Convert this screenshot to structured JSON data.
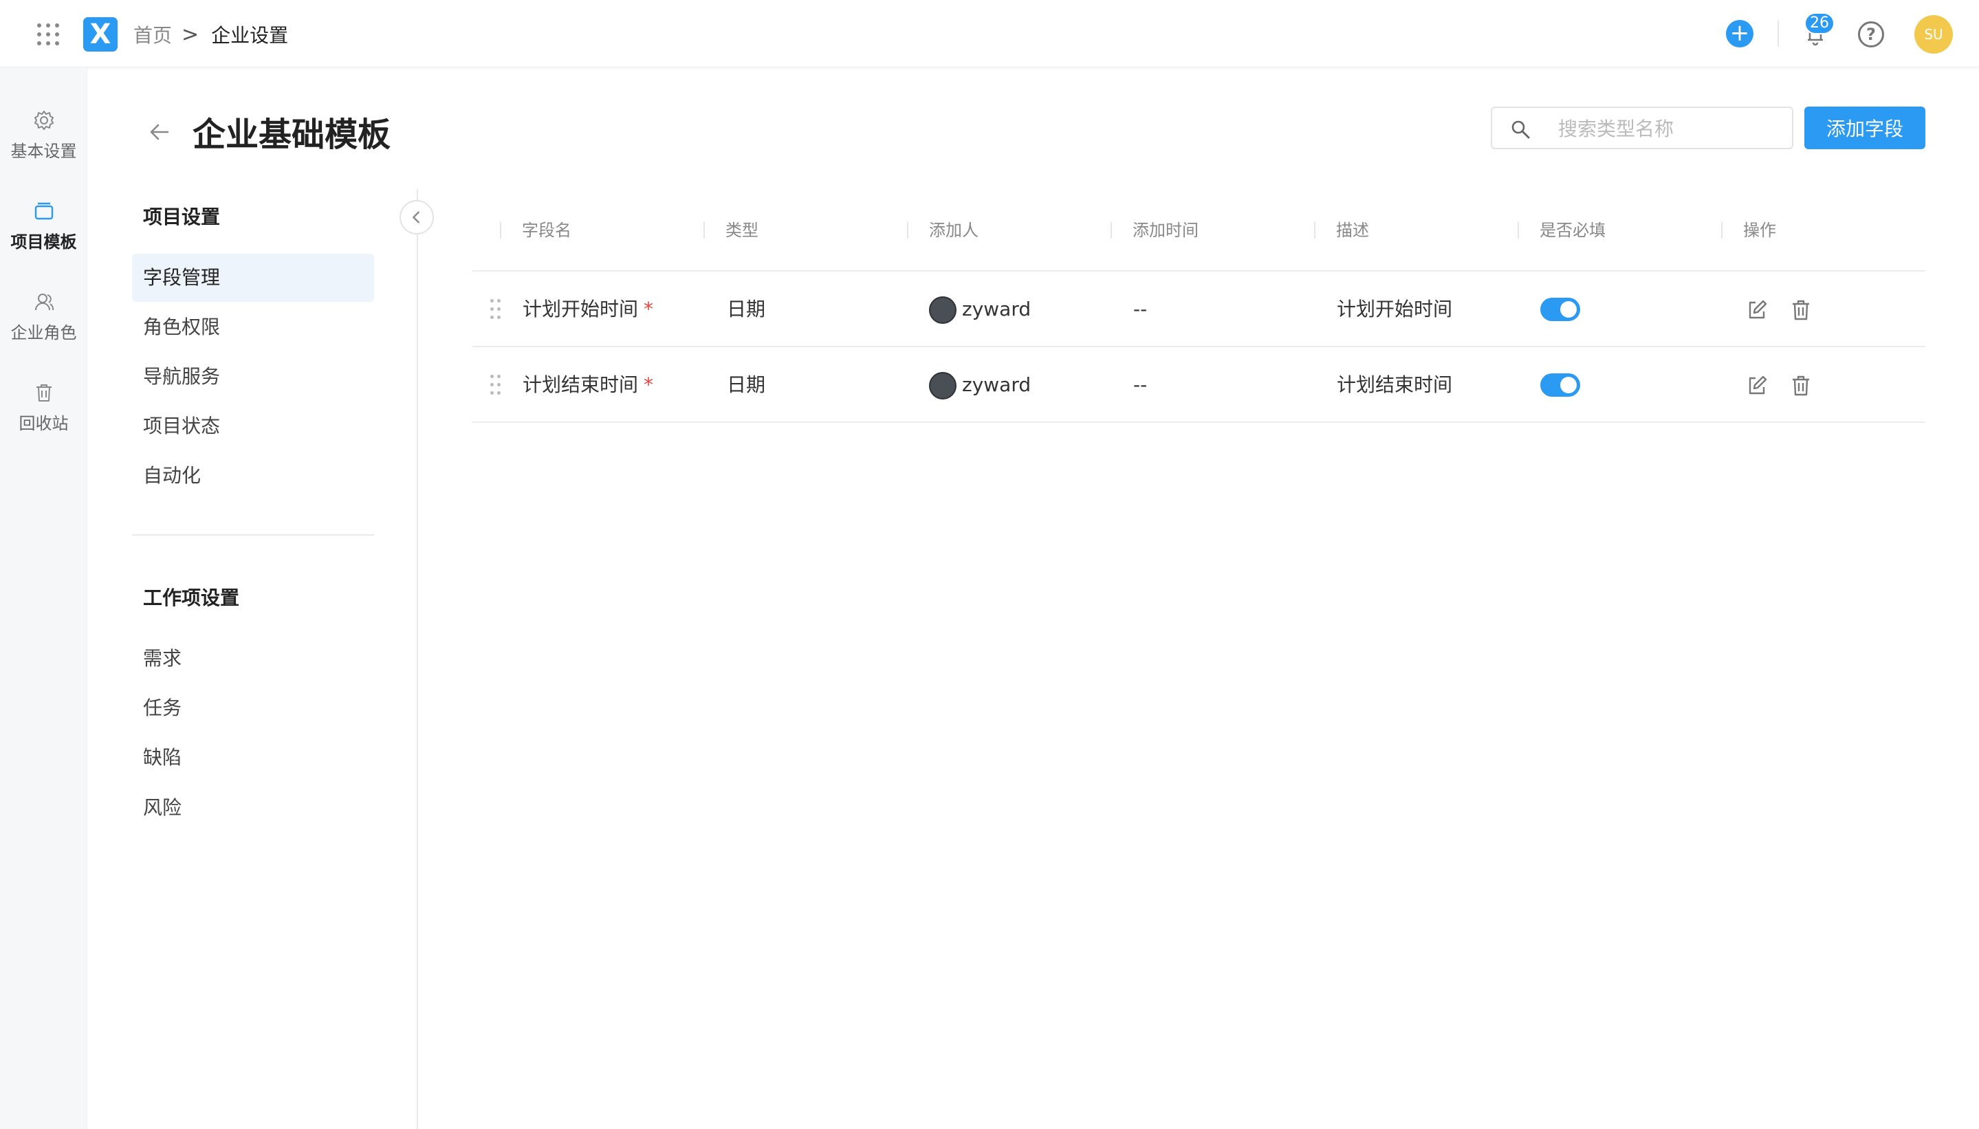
{
  "topbar": {
    "logo_text": "X",
    "breadcrumb": {
      "home": "首页",
      "separator": ">",
      "current": "企业设置"
    },
    "notification_count": "26",
    "help_label": "?",
    "avatar_initials": "SU",
    "add_label": "+"
  },
  "rail": {
    "items": [
      {
        "label": "基本设置",
        "icon": "gear-icon"
      },
      {
        "label": "项目模板",
        "icon": "template-icon",
        "active": true
      },
      {
        "label": "企业角色",
        "icon": "users-icon"
      },
      {
        "label": "回收站",
        "icon": "trash-icon"
      }
    ]
  },
  "page": {
    "title": "企业基础模板",
    "search_placeholder": "搜索类型名称",
    "search_value": "",
    "add_button": "添加字段"
  },
  "nav": {
    "project_section": "项目设置",
    "project_items": [
      "字段管理",
      "角色权限",
      "导航服务",
      "项目状态",
      "自动化"
    ],
    "active_item": "字段管理",
    "work_section": "工作项设置",
    "work_items": [
      "需求",
      "任务",
      "缺陷",
      "风险"
    ]
  },
  "table": {
    "columns": [
      "字段名",
      "类型",
      "添加人",
      "添加时间",
      "描述",
      "是否必填",
      "操作"
    ],
    "rows": [
      {
        "name": "计划开始时间",
        "required_mark": "*",
        "type": "日期",
        "creator": "zyward",
        "time": "--",
        "desc": "计划开始时间",
        "required": true
      },
      {
        "name": "计划结束时间",
        "required_mark": "*",
        "type": "日期",
        "creator": "zyward",
        "time": "--",
        "desc": "计划结束时间",
        "required": true
      }
    ]
  },
  "colors": {
    "accent": "#2b9af3",
    "required": "#e5453b",
    "avatar": "#f2c94c"
  }
}
